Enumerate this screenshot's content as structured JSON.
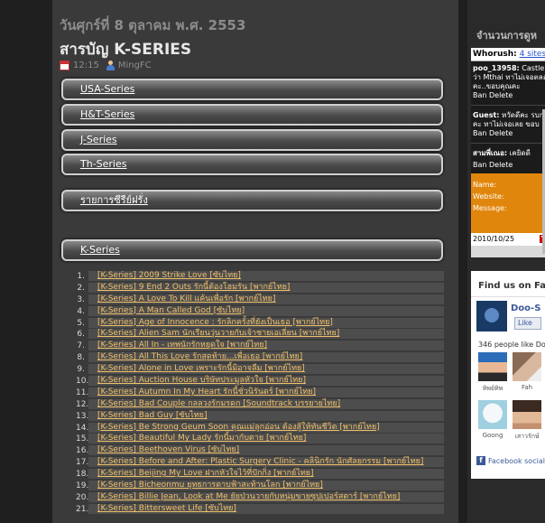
{
  "post": {
    "date": "วันศุกร์ที่ 8 ตุลาคม พ.ศ. 2553",
    "title": "สารบัญ K-SERIES",
    "time": "12:15",
    "author": "MingFC"
  },
  "menu": [
    "USA-Series",
    "H&T-Series",
    "J-Series",
    "Th-Series",
    "รายการซีรีย์ฝรั่ง",
    "K-Series"
  ],
  "series_list": [
    "[K-Series] 2009 Strike Love [ซับไทย]",
    "[K-Series] 9 End 2 Outs รักนี้ต้องโฮมรัน [พากย์ไทย]",
    "[K-Series] A Love To Kill แค้นเพื่อรัก [พากย์ไทย]",
    "[K-Series] A Man Called God [ซับไทย]",
    "[K-Series] Age of Innocence : รักลิกครั้งที่ยังเป็นเธอ [พากย์ไทย]",
    "[K-Series] Alien Sam นักเรียนวุ่นวายกับเจ้าชายเอเลี่ยน [พากย์ไทย]",
    "[K-Series] All In - เทพนักรักหยุดใจ [พากย์ไทย]",
    "[K-Series] All This Love รักสุดท้าย...เพื่อเธอ [พากย์ไทย]",
    "[K-Series] Alone in Love เพราะรักนี้มิอาจลืม [พากย์ไทย]",
    "[K-Series] Auction House บริษัทประมูลหัวใจ [พากย์ไทย]",
    "[K-Series] Autumn In My Heart รักนี้ชั่วนิรันดร์ [พากย์ไทย]",
    "[K-Series] Bad Couple กลลวงรักมรดก [Soundtrack บรรยายไทย]",
    "[K-Series] Bad Guy [ซับไทย]",
    "[K-Series] Be Strong Geum Soon คุณแม่ลูกอ่อน ต้องสู้ให้ทันชีวิต [พากย์ไทย]",
    "[K-Series] Beautiful My Lady รักนี้มากับตาย [พากย์ไทย]",
    "[K-Series] Beethoven Virus [ซับไทย]",
    "[K-Series] Before and After: Plastic Surgery Clinic - คลินิกรัก นักศัลยกรรม [พากย์ไทย]",
    "[K-Series] Beijing My Love ฝากหัวใจไว้ที่ปักกิ่ง [พากย์ไทย]",
    "[K-Series] Bicheonmu ยุทธการดาบฟ้าสะท้านโลก [พากย์ไทย]",
    "[K-Series] Billie Jean, Look at Me ยัยป่วนวายกับหนุ่มขายซุปเปอร์สตาร์ [พากย์ไทย]",
    "[K-Series] Bittersweet Life [ซับไทย]"
  ],
  "sidebar": {
    "counter_title": "จำนวนการดูห",
    "cbox": {
      "header_label": "Whorush:",
      "header_link": "4 sites b",
      "messages": [
        {
          "who": "poo_13958:",
          "lines": [
            "Castle",
            "ว่า Mthai ทาไม่เจอตลอด",
            "คะ..ขอบคุณคะ"
          ],
          "action": "Ban Delete"
        },
        {
          "who": "Guest:",
          "lines": [
            "หวัดดีคะ รบก",
            "คะ ทาไม่เจอเลย ขอบ"
          ],
          "action": "Ban Delete"
        },
        {
          "who": "สามพี่เณอ:",
          "lines": [
            "เคยิดดี"
          ],
          "action": "Ban Delete"
        }
      ],
      "form_labels": [
        "Name:",
        "Website:",
        "Message:"
      ],
      "clock": "2010/10/25",
      "yahoo_letter": "Y"
    },
    "facebook": {
      "title": "Find us on Face",
      "page_name": "Doo-S",
      "like_label": "Like",
      "count_text": "346 people like Doo-",
      "fans": [
        "ทิพย์ทิพ",
        "Fah",
        "Goong",
        "เสาวรักษ์"
      ],
      "social_label": "Facebook social"
    }
  },
  "colors": {
    "page_bg": "#1f1f1f",
    "main_bg": "#3a3a3a",
    "link": "#f0c06a",
    "cbox_orange": "#e0860c",
    "facebook_blue": "#3b5998"
  }
}
